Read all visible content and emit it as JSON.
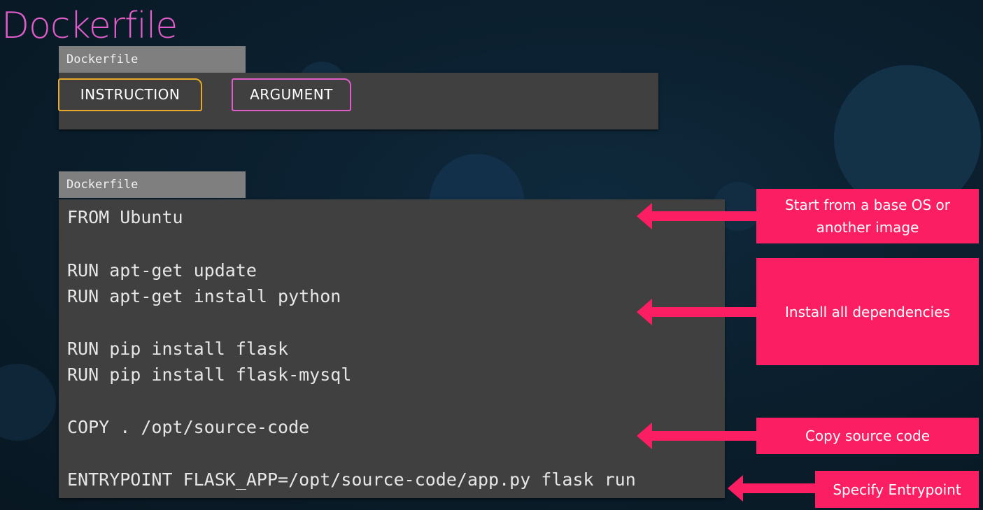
{
  "slide": {
    "title": "Dockerfile"
  },
  "top_box": {
    "tab_label": "Dockerfile",
    "instruction_label": "INSTRUCTION",
    "argument_label": "ARGUMENT",
    "colors": {
      "instruction_border": "#e8a92b",
      "argument_border": "#e05cc8"
    }
  },
  "bottom_box": {
    "tab_label": "Dockerfile",
    "lines": [
      "FROM Ubuntu",
      "RUN apt-get update",
      "RUN apt-get install python",
      "RUN pip install flask",
      "RUN pip install flask-mysql",
      "COPY . /opt/source-code",
      "ENTRYPOINT FLASK_APP=/opt/source-code/app.py flask run"
    ]
  },
  "callouts": {
    "base_os": "Start from a base OS or another image",
    "dependencies": "Install all dependencies",
    "copy_source": "Copy source code",
    "entrypoint": "Specify Entrypoint"
  },
  "colors": {
    "accent_pink": "#fc1e63",
    "title_color": "#e05cc8",
    "panel_bg": "#404040",
    "tab_bg": "#7f7f7f"
  }
}
